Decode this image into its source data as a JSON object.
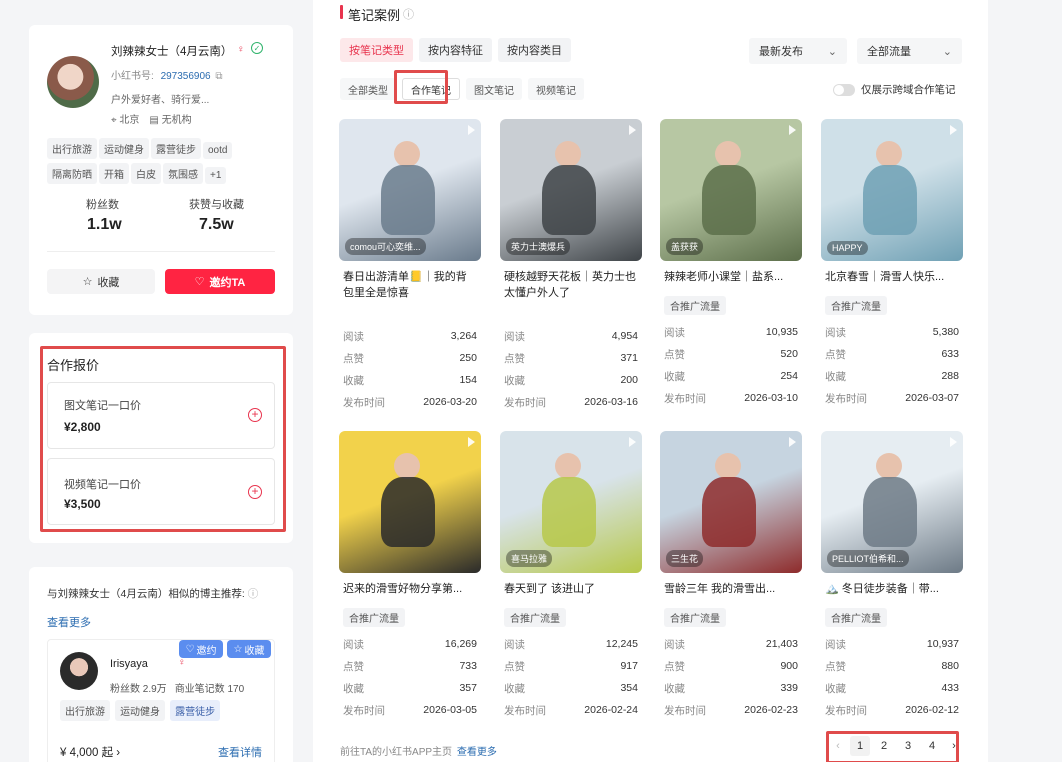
{
  "profile": {
    "name": "刘辣辣女士（4月云南）",
    "id_label": "小红书号:",
    "id_value": "297356906",
    "bio": "户外爱好者、骑行爱...",
    "location": "北京",
    "org": "无机构",
    "tags": [
      "出行旅游",
      "运动健身",
      "露营徒步",
      "ootd",
      "隔离防晒",
      "开箱",
      "白皮",
      "氛围感",
      "+1"
    ],
    "followers_label": "粉丝数",
    "followers_value": "1.1w",
    "likes_label": "获赞与收藏",
    "likes_value": "7.5w",
    "collect_btn": "收藏",
    "invite_btn": "邀约TA"
  },
  "pricing": {
    "title": "合作报价",
    "items": [
      {
        "label": "图文笔记一口价",
        "price": "¥2,800"
      },
      {
        "label": "视频笔记一口价",
        "price": "¥3,500"
      }
    ]
  },
  "similar": {
    "title": "与刘辣辣女士（4月云南）相似的博主推荐:",
    "more": "查看更多",
    "card": {
      "name": "Irisyaya",
      "followers": "粉丝数 2.9万",
      "notes": "商业笔记数 170",
      "invite": "邀约",
      "collect": "收藏",
      "tags": [
        "出行旅游",
        "运动健身",
        "露营徒步"
      ],
      "price": "¥ 4,000 起",
      "detail": "查看详情"
    }
  },
  "notes": {
    "title": "笔记案例",
    "tabs": [
      "按笔记类型",
      "按内容特征",
      "按内容类目"
    ],
    "sort": "最新发布",
    "traffic": "全部流量",
    "subtabs": [
      "全部类型",
      "合作笔记",
      "图文笔记",
      "视频笔记"
    ],
    "toggle_label": "仅展示跨域合作笔记",
    "stat_labels": {
      "read": "阅读",
      "like": "点赞",
      "fav": "收藏",
      "date": "发布时间"
    },
    "cards": [
      {
        "title": "春日出游清单📒｜我的背包里全是惊喜",
        "tag": "",
        "author": "comou可心奕维...",
        "read": "3,264",
        "like": "250",
        "fav": "154",
        "date": "2026-03-20",
        "c1": "#dfe6ee",
        "c2": "#6a7b8c"
      },
      {
        "title": "硬核越野天花板｜英力士也太懂户外人了",
        "tag": "",
        "author": "英力士澳爆兵",
        "read": "4,954",
        "like": "371",
        "fav": "200",
        "date": "2026-03-16",
        "c1": "#c9ced3",
        "c2": "#3e4347"
      },
      {
        "title": "辣辣老师小课堂｜盐系...",
        "tag": "合推广流量",
        "author": "盖获获",
        "read": "10,935",
        "like": "520",
        "fav": "254",
        "date": "2026-03-10",
        "c1": "#b7c7a3",
        "c2": "#5c6e4a"
      },
      {
        "title": "北京春雪｜滑雪人快乐...",
        "tag": "合推广流量",
        "author": "HAPPY",
        "read": "5,380",
        "like": "633",
        "fav": "288",
        "date": "2026-03-07",
        "c1": "#cfe0e8",
        "c2": "#6fa0b4"
      },
      {
        "title": "迟来的滑雪好物分享第...",
        "tag": "合推广流量",
        "author": "",
        "read": "16,269",
        "like": "733",
        "fav": "357",
        "date": "2026-03-05",
        "c1": "#f2d24b",
        "c2": "#2a2a2a"
      },
      {
        "title": "春天到了 该进山了",
        "tag": "合推广流量",
        "author": "喜马拉雅",
        "read": "12,245",
        "like": "917",
        "fav": "354",
        "date": "2026-02-24",
        "c1": "#d8e3ea",
        "c2": "#b7c84a"
      },
      {
        "title": "雪龄三年 我的滑雪出...",
        "tag": "合推广流量",
        "author": "三生花",
        "read": "21,403",
        "like": "900",
        "fav": "339",
        "date": "2026-02-23",
        "c1": "#c6d4e0",
        "c2": "#8e2b2b"
      },
      {
        "title": "🏔️ 冬日徒步装备｜带...",
        "tag": "合推广流量",
        "author": "PELLIOT伯希和...",
        "read": "10,937",
        "like": "880",
        "fav": "433",
        "date": "2026-02-12",
        "c1": "#e6edf2",
        "c2": "#6d7a86"
      }
    ],
    "footer_text": "前往TA的小红书APP主页",
    "footer_link": "查看更多",
    "pages": [
      "1",
      "2",
      "3",
      "4"
    ]
  },
  "colors": {
    "brand": "#ff2442",
    "highlight": "#e04b4b"
  }
}
